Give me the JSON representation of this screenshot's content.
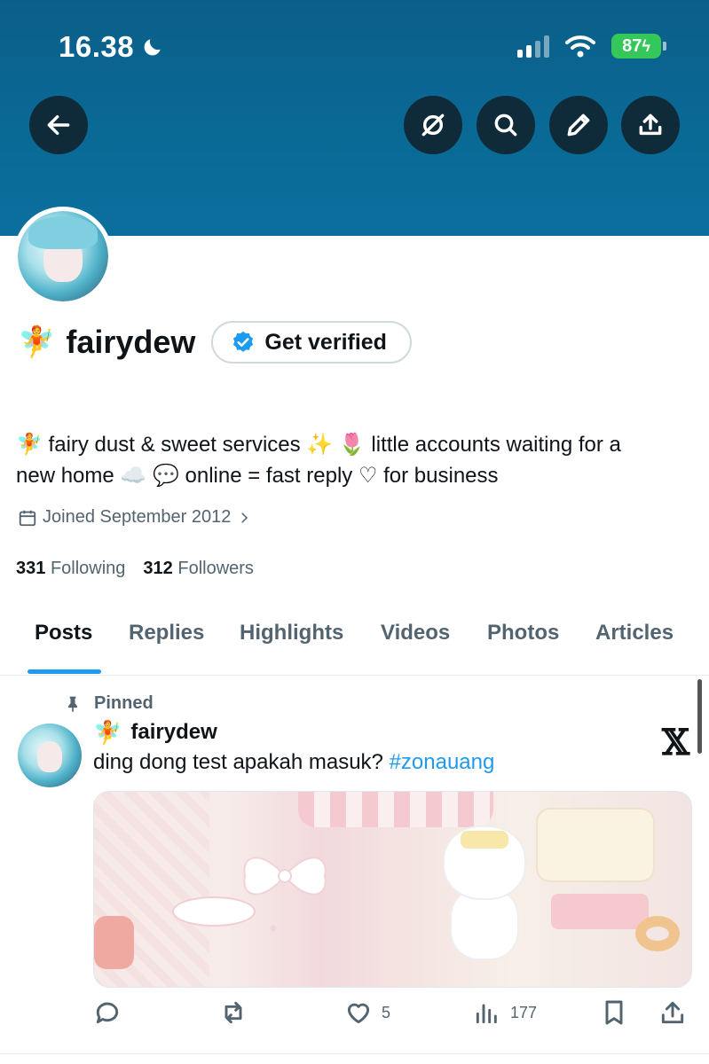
{
  "status_bar": {
    "time": "16.38",
    "battery": "87"
  },
  "header": {
    "back_icon": "arrow-left-icon",
    "buttons": [
      "grok-icon",
      "search-icon",
      "edit-icon",
      "share-icon"
    ]
  },
  "profile": {
    "name_emoji": "🧚",
    "display_name": "fairydew",
    "get_verified_label": "Get verified",
    "bio_line1": "🧚 fairy dust & sweet services ✨ 🌷 little accounts waiting for a",
    "bio_line2": "new home ☁️ 💬 online = fast reply ♡ for business",
    "joined": "Joined September 2012",
    "following_count": "331",
    "following_label": "Following",
    "followers_count": "312",
    "followers_label": "Followers"
  },
  "tabs": [
    "Posts",
    "Replies",
    "Highlights",
    "Videos",
    "Photos",
    "Articles"
  ],
  "pinned_post": {
    "pinned_label": "Pinned",
    "author_emoji": "🧚",
    "author": "fairydew",
    "text": "ding dong test apakah masuk? ",
    "hashtag": "#zonauang",
    "x_logo": "𝕏",
    "likes": "5",
    "views": "177"
  }
}
